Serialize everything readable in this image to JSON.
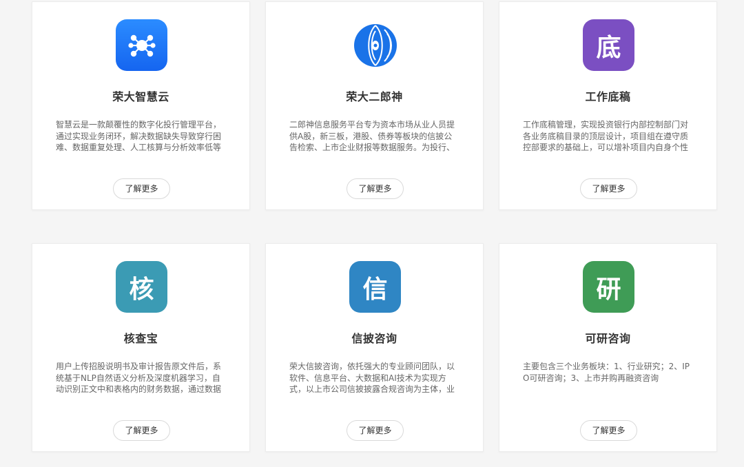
{
  "cards": [
    {
      "title": "荣大智慧云",
      "icon": "network-nodes-icon",
      "color": "#1e7cf5",
      "desc": "智慧云是一款颠覆性的数字化投行管理平台，通过实现业务闭环，解决数据缺失导致穿行困难、数据重复处理、人工核算与分析效率低等问题",
      "button": "了解更多"
    },
    {
      "title": "荣大二郎神",
      "icon": "eye-globe-icon",
      "color": "#1e7cf5",
      "desc": "二郎神信息服务平台专为资本市场从业人员提供A股，新三板，港股、债券等板块的信披公告检索、上市企业财报等数据服务。为投行、上市",
      "button": "了解更多"
    },
    {
      "title": "工作底稿",
      "icon_char": "底",
      "color": "#7b4fc2",
      "desc": "工作底稿管理，实现投资银行内部控制部门对各业务底稿目录的顶层设计，项目组在遵守质控部要求的基础上，可以增补项目内自身个性化的底",
      "button": "了解更多"
    },
    {
      "title": "核查宝",
      "icon_char": "核",
      "color": "#3b9bb4",
      "desc": "用户上传招股说明书及审计报告原文件后，系统基于NLP自然语义分析及深度机器学习，自动识别正文中和表格内的财务数据，通过数据对比",
      "button": "了解更多"
    },
    {
      "title": "信披咨询",
      "icon_char": "信",
      "color": "#2f86c4",
      "desc": "荣大信披咨询，依托强大的专业顾问团队，以软件、信息平台、大数据和AI技术为实现方式，以上市公司信披披露合规咨询为主体，业务覆盖",
      "button": "了解更多"
    },
    {
      "title": "可研咨询",
      "icon_char": "研",
      "color": "#3f9c56",
      "desc": "主要包含三个业务板块：1、行业研究；2、IPO可研咨询；3、上市并购再融资咨询",
      "button": "了解更多"
    }
  ]
}
